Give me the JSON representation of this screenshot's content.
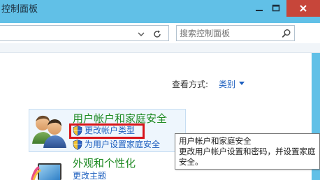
{
  "window": {
    "title": "控制面板"
  },
  "search": {
    "placeholder": "搜索控制面板"
  },
  "view_by": {
    "label": "查看方式:",
    "value": "类别"
  },
  "categories": [
    {
      "title": "用户帐户和家庭安全",
      "icon": "users-icon",
      "links": [
        "更改帐户类型",
        "为用户设置家庭安全"
      ]
    },
    {
      "title": "外观和个性化",
      "icon": "monitor-icon",
      "links": [
        "更改主题"
      ]
    }
  ],
  "tooltip": {
    "title": "用户帐户和家庭安全",
    "body": "更改用户帐户设置和密码，并设置家庭安全。"
  },
  "colors": {
    "titlebar": "#61c0e7",
    "close_button": "#c7463a",
    "category_title": "#1e8a23",
    "link": "#1d5fbf",
    "highlight": "#d8141a"
  }
}
